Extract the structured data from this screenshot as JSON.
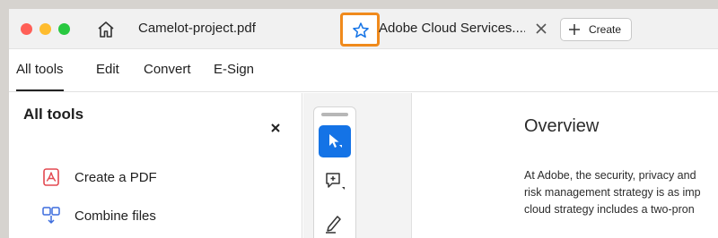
{
  "titlebar": {
    "tab1_title": "Camelot-project.pdf",
    "tab2_title": "Adobe Cloud Services....",
    "create_label": "Create",
    "icons": {
      "home": "home-icon",
      "star": "star-outline-icon",
      "close": "close-icon",
      "plus": "plus-icon"
    },
    "highlight_color": "#f08a1c"
  },
  "nav": {
    "tabs": [
      "All tools",
      "Edit",
      "Convert",
      "E-Sign"
    ],
    "active": "All tools"
  },
  "left_panel": {
    "title": "All tools",
    "items": [
      {
        "label": "Create a PDF",
        "icon": "create-pdf-icon",
        "color": "#e34850"
      },
      {
        "label": "Combine files",
        "icon": "combine-files-icon",
        "color": "#3d6ddd"
      }
    ]
  },
  "toolbar": {
    "tools": [
      "select-cursor-icon",
      "add-comment-icon",
      "draw-pen-icon"
    ],
    "active_color": "#1473e6"
  },
  "document": {
    "heading": "Overview",
    "lines": [
      "At Adobe, the security, privacy and",
      "risk management strategy is as imp",
      "cloud strategy includes a two-pron"
    ]
  }
}
